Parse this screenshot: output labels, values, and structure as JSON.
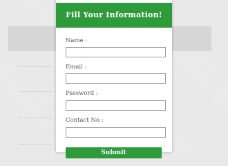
{
  "form": {
    "title": "Fill Your Information!",
    "fields": [
      {
        "label": "Name :",
        "value": ""
      },
      {
        "label": "Email :",
        "value": ""
      },
      {
        "label": "Password :",
        "value": ""
      },
      {
        "label": "Contact No :",
        "value": ""
      }
    ],
    "submit_label": "Submit"
  },
  "colors": {
    "header_bg": "#2e9b3b",
    "button_bg": "#2e9b3b",
    "card_bg": "#ffffff",
    "page_bg": "#ececec"
  }
}
